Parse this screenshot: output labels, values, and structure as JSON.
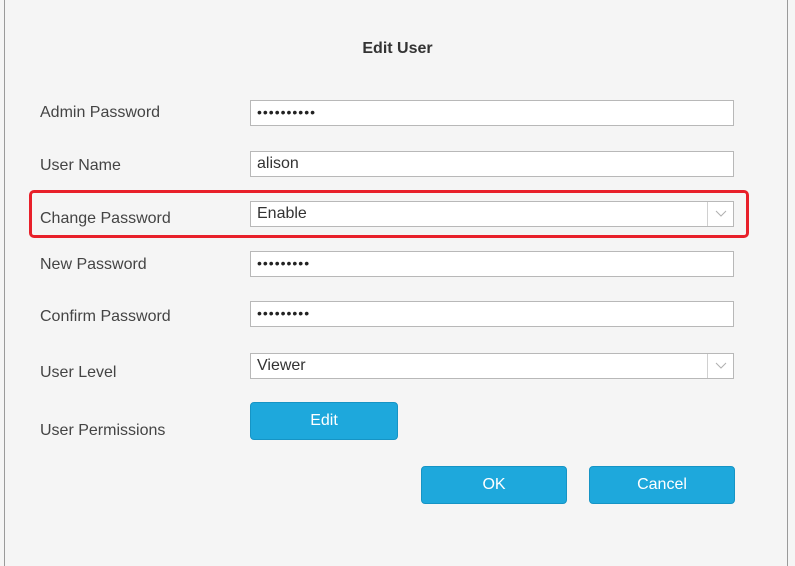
{
  "dialog": {
    "title": "Edit User"
  },
  "fields": {
    "admin_password": {
      "label": "Admin Password",
      "value": "••••••••••"
    },
    "user_name": {
      "label": "User Name",
      "value": "alison"
    },
    "change_password": {
      "label": "Change Password",
      "value": "Enable"
    },
    "new_password": {
      "label": "New Password",
      "value": "•••••••••"
    },
    "confirm_password": {
      "label": "Confirm Password",
      "value": "•••••••••"
    },
    "user_level": {
      "label": "User Level",
      "value": "Viewer"
    },
    "user_permissions": {
      "label": "User Permissions",
      "button_label": "Edit"
    }
  },
  "buttons": {
    "ok": "OK",
    "cancel": "Cancel"
  },
  "colors": {
    "button_bg": "#1ea8dc",
    "highlight": "#e8202a"
  },
  "icons": {
    "select_arrow": "chevron-down-icon"
  }
}
